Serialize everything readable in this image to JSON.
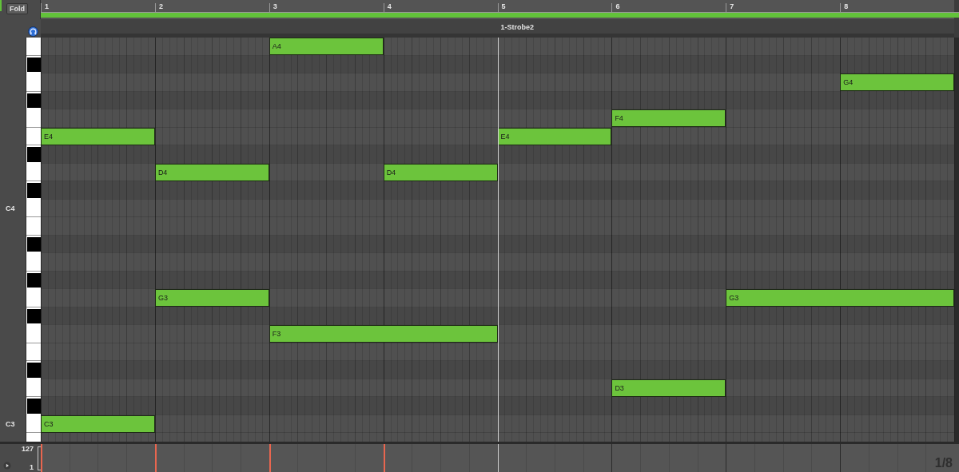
{
  "fold_button": {
    "label": "Fold"
  },
  "ruler": {
    "bars": [
      "1",
      "2",
      "3",
      "4",
      "5",
      "6",
      "7",
      "8"
    ]
  },
  "clip": {
    "name": "1-Strobe2"
  },
  "keys": [
    {
      "kind": "white"
    },
    {
      "kind": "black"
    },
    {
      "kind": "white"
    },
    {
      "kind": "black"
    },
    {
      "kind": "white"
    },
    {
      "kind": "white"
    },
    {
      "kind": "black"
    },
    {
      "kind": "white"
    },
    {
      "kind": "black"
    },
    {
      "kind": "white"
    },
    {
      "kind": "white"
    },
    {
      "kind": "black"
    },
    {
      "kind": "white"
    },
    {
      "kind": "black"
    },
    {
      "kind": "white"
    },
    {
      "kind": "black"
    },
    {
      "kind": "white"
    },
    {
      "kind": "white"
    },
    {
      "kind": "black"
    },
    {
      "kind": "white"
    },
    {
      "kind": "black"
    },
    {
      "kind": "white"
    },
    {
      "kind": "white"
    }
  ],
  "key_labels": [
    "C4",
    "C3"
  ],
  "notes": [
    {
      "label": "A4"
    },
    {
      "label": "G4"
    },
    {
      "label": "F4"
    },
    {
      "label": "E4"
    },
    {
      "label": "E4"
    },
    {
      "label": "D4"
    },
    {
      "label": "D4"
    },
    {
      "label": "G3"
    },
    {
      "label": "G3"
    },
    {
      "label": "F3"
    },
    {
      "label": "D3"
    },
    {
      "label": "C3"
    }
  ],
  "velocity": {
    "max_label": "127",
    "min_label": "1",
    "grid_label": "1/8"
  }
}
